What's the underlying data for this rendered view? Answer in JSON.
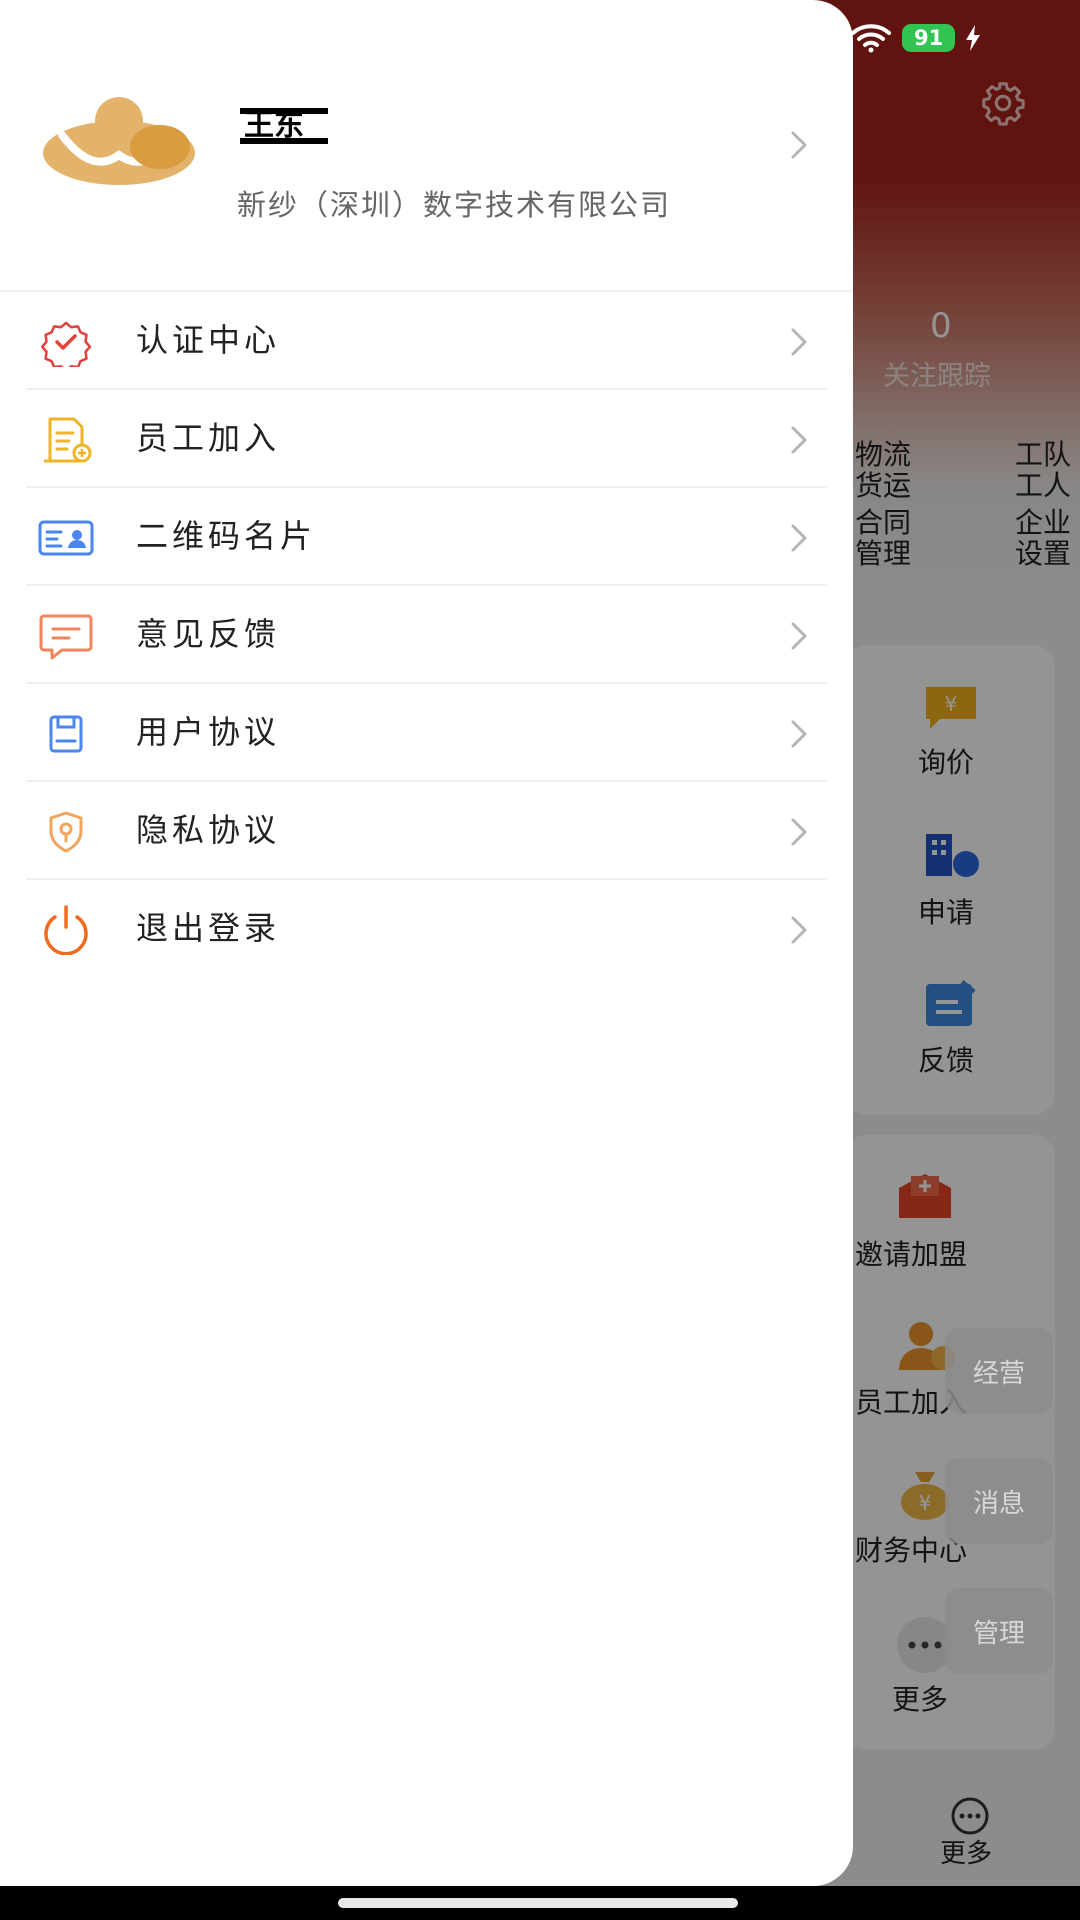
{
  "status_bar": {
    "battery": "91"
  },
  "background": {
    "follow_count": "0",
    "follow_label": "关注跟踪",
    "grid_row1": [
      "物流\n货运",
      "工队\n工人"
    ],
    "grid_row2": [
      "合同\n管理",
      "企业\n设置"
    ],
    "card1": [
      "询价",
      "申请",
      "反馈"
    ],
    "card2": [
      "邀请加盟",
      "员工加入",
      "财务中心",
      "更多"
    ],
    "float_buttons": [
      "经营",
      "消息",
      "管理"
    ],
    "tab_more": "更多"
  },
  "profile": {
    "name": "王东",
    "company": "新纱（深圳）数字技术有限公司"
  },
  "menu": [
    {
      "label": "认证中心",
      "icon": "certificate-badge-icon",
      "color": "#e0433e"
    },
    {
      "label": "员工加入",
      "icon": "employee-join-icon",
      "color": "#f0b429"
    },
    {
      "label": "二维码名片",
      "icon": "qr-business-card-icon",
      "color": "#4a86f0"
    },
    {
      "label": "意见反馈",
      "icon": "feedback-chat-icon",
      "color": "#f2845c"
    },
    {
      "label": "用户协议",
      "icon": "user-agreement-icon",
      "color": "#4a86f0"
    },
    {
      "label": "隐私协议",
      "icon": "privacy-shield-icon",
      "color": "#f2a55c"
    },
    {
      "label": "退出登录",
      "icon": "logout-power-icon",
      "color": "#f06a1d"
    }
  ]
}
